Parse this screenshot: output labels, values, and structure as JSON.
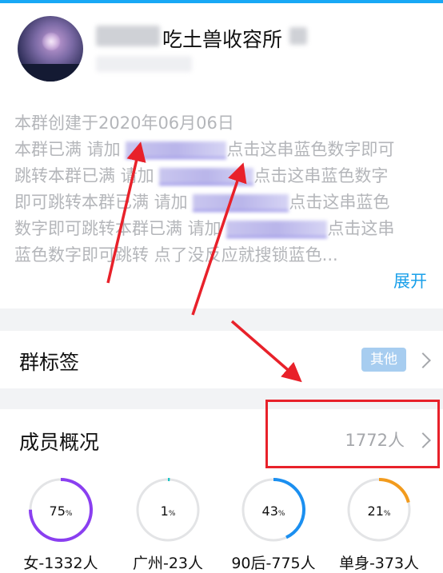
{
  "group": {
    "name": "吃土兽收容所"
  },
  "description": {
    "lines": [
      [
        "本群创建于2020年06月06日",
        "",
        ""
      ],
      [
        "本群已满 请加",
        "",
        "点击这串蓝色数字即可"
      ],
      [
        "跳转本群已满 请加",
        "",
        "点击这串蓝色数字"
      ],
      [
        "即可跳转本群已满 请加",
        "",
        "点击这串蓝色"
      ],
      [
        "数字即可跳转本群已满 请加",
        "",
        "点击这串"
      ],
      [
        "蓝色数字即可跳转 点了没反应就搜锁蓝色...",
        "",
        ""
      ]
    ],
    "expand_label": "展开"
  },
  "tags_row": {
    "title": "群标签",
    "tag": "其他"
  },
  "members_row": {
    "title": "成员概况",
    "count": "1772人"
  },
  "stats": [
    {
      "value": "75",
      "unit": "%",
      "label": "女-1332人",
      "fraction": 0.75,
      "color": "#8a3ff0"
    },
    {
      "value": "1",
      "unit": "%",
      "label": "广州-23人",
      "fraction": 0.01,
      "color": "#19c3c3"
    },
    {
      "value": "43",
      "unit": "%",
      "label": "90后-775人",
      "fraction": 0.43,
      "color": "#1b8ff0"
    },
    {
      "value": "21",
      "unit": "%",
      "label": "单身-373人",
      "fraction": 0.21,
      "color": "#f29b1d"
    }
  ],
  "colors": {
    "accent": "#1aa0ea",
    "annotation": "#e8212a",
    "track": "#e3e4e6"
  }
}
